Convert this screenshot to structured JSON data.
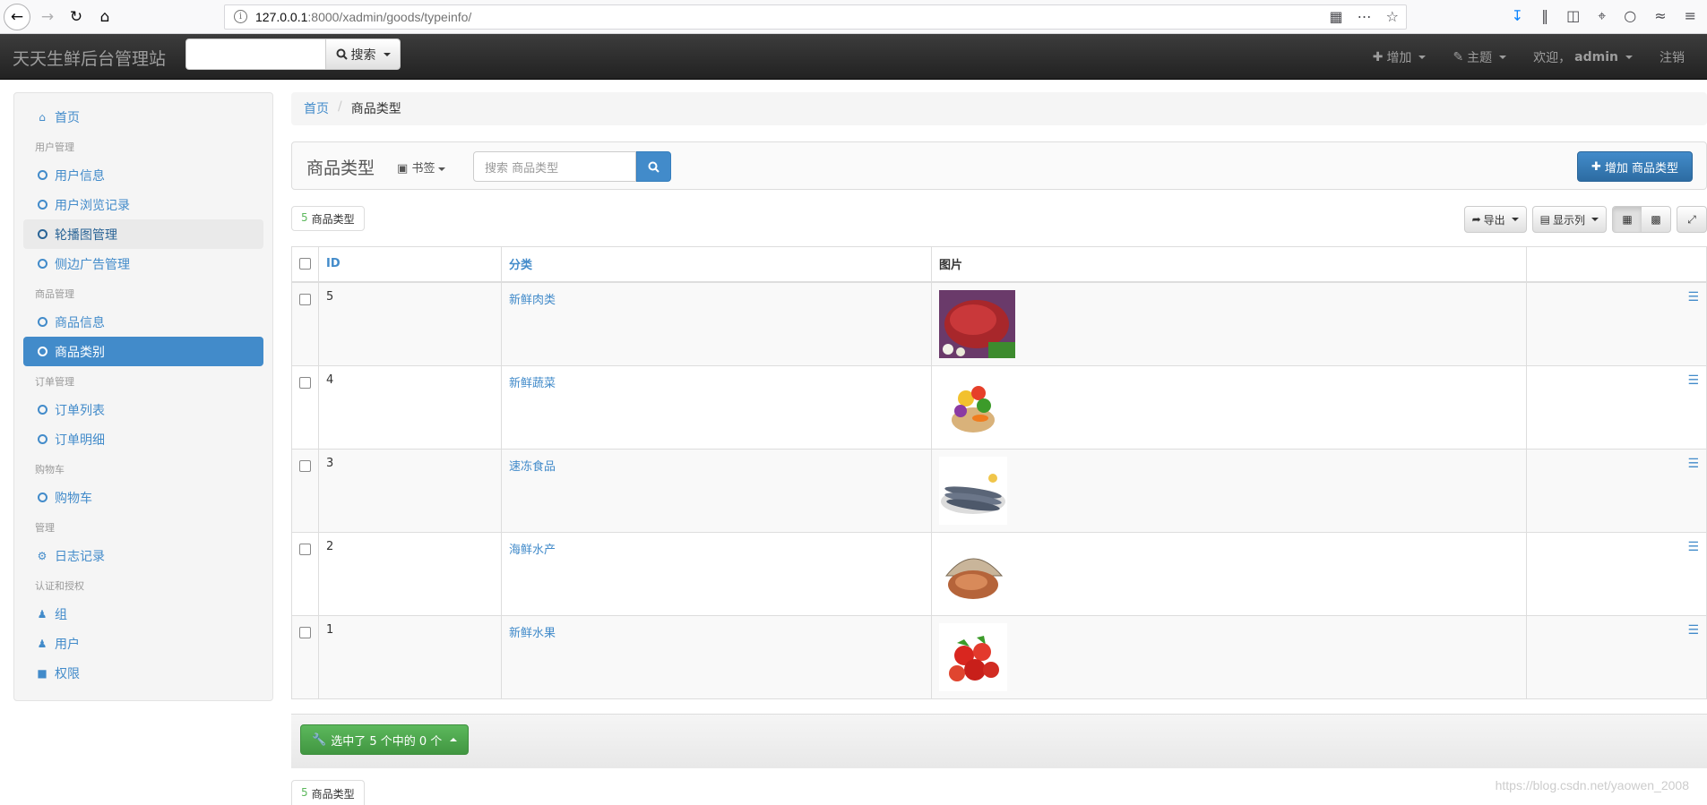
{
  "browser": {
    "url_host": "127.0.0.1",
    "url_rest": ":8000/xadmin/goods/typeinfo/"
  },
  "navbar": {
    "brand": "天天生鲜后台管理站",
    "search_label": "搜索",
    "add_label": "增加",
    "theme_label": "主题",
    "welcome_label": "欢迎，",
    "user": "admin",
    "logout_label": "注销"
  },
  "sidebar": {
    "home": "首页",
    "group_users": "用户管理",
    "user_info": "用户信息",
    "user_browse": "用户浏览记录",
    "banner": "轮播图管理",
    "side_ads": "侧边广告管理",
    "group_goods": "商品管理",
    "goods_info": "商品信息",
    "goods_type": "商品类别",
    "group_orders": "订单管理",
    "order_list": "订单列表",
    "order_detail": "订单明细",
    "group_cart": "购物车",
    "cart": "购物车",
    "group_admin": "管理",
    "log": "日志记录",
    "group_auth": "认证和授权",
    "groups": "组",
    "users": "用户",
    "perms": "权限"
  },
  "breadcrumb": {
    "home": "首页",
    "current": "商品类型"
  },
  "panel": {
    "title": "商品类型",
    "bookmark": "书签",
    "search_placeholder": "搜索 商品类型",
    "add_button": "增加 商品类型"
  },
  "toolbar": {
    "count": "5",
    "count_label": "商品类型",
    "export": "导出",
    "columns": "显示列"
  },
  "table": {
    "headers": {
      "id": "ID",
      "category": "分类",
      "image": "图片"
    },
    "rows": [
      {
        "id": "5",
        "name": "新鲜肉类"
      },
      {
        "id": "4",
        "name": "新鲜蔬菜"
      },
      {
        "id": "3",
        "name": "速冻食品"
      },
      {
        "id": "2",
        "name": "海鲜水产"
      },
      {
        "id": "1",
        "name": "新鲜水果"
      }
    ]
  },
  "footer": {
    "selection": "选中了 5 个中的 0 个",
    "count": "5",
    "count_label": "商品类型"
  },
  "watermark": "https://blog.csdn.net/yaowen_2008",
  "colors": {
    "primary": "#428bca",
    "success": "#5cb85c",
    "navbar": "#222222"
  }
}
